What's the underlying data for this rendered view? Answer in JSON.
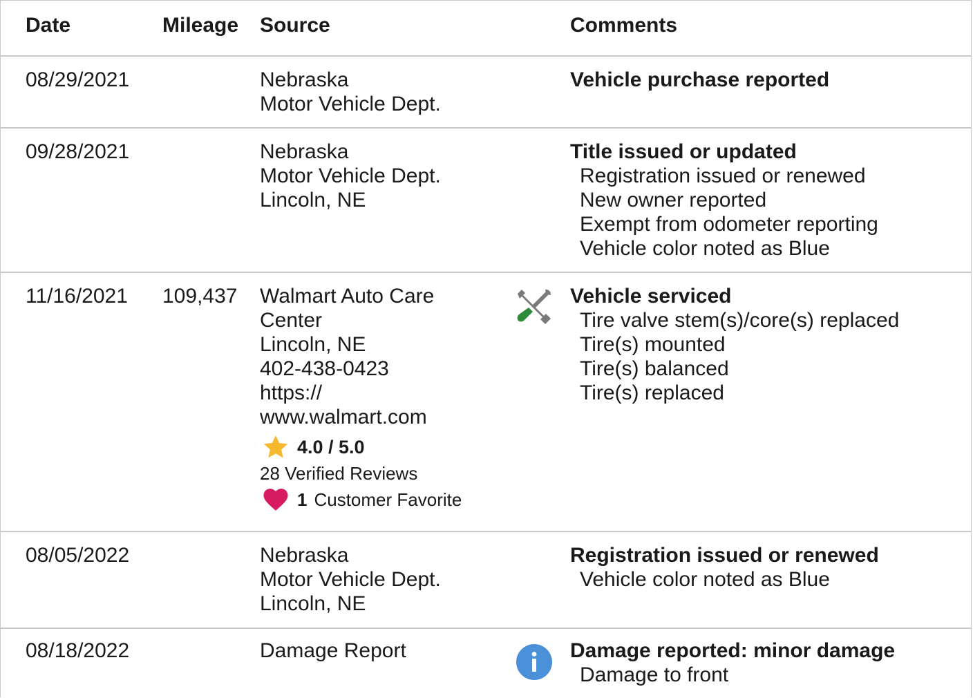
{
  "header": {
    "date": "Date",
    "mileage": "Mileage",
    "source": "Source",
    "comments": "Comments"
  },
  "rows": [
    {
      "date": "08/29/2021",
      "mileage": "",
      "source": [
        "Nebraska",
        "Motor Vehicle Dept."
      ],
      "icon": "",
      "comment_title": "Vehicle purchase reported",
      "comment_details": []
    },
    {
      "date": "09/28/2021",
      "mileage": "",
      "source": [
        "Nebraska",
        "Motor Vehicle Dept.",
        "Lincoln, NE"
      ],
      "icon": "",
      "comment_title": "Title issued or updated",
      "comment_details": [
        "Registration issued or renewed",
        "New owner reported",
        "Exempt from odometer reporting",
        "Vehicle color noted as Blue"
      ]
    },
    {
      "date": "11/16/2021",
      "mileage": "109,437",
      "source": [
        "Walmart Auto Care",
        "Center",
        "Lincoln, NE",
        "402-438-0423",
        "https://",
        "www.walmart.com"
      ],
      "rating": "4.0 / 5.0",
      "reviews": "28 Verified Reviews",
      "favorite_count": "1",
      "favorite_label": "Customer Favorite",
      "icon": "wrench-screwdriver-icon",
      "comment_title": "Vehicle serviced",
      "comment_details": [
        "Tire valve stem(s)/core(s) replaced",
        "Tire(s) mounted",
        "Tire(s) balanced",
        "Tire(s) replaced"
      ]
    },
    {
      "date": "08/05/2022",
      "mileage": "",
      "source": [
        "Nebraska",
        "Motor Vehicle Dept.",
        "Lincoln, NE"
      ],
      "icon": "",
      "comment_title": "Registration issued or renewed",
      "comment_details": [
        "Vehicle color noted as Blue"
      ]
    },
    {
      "date": "08/18/2022",
      "mileage": "",
      "source": [
        "Damage Report"
      ],
      "icon": "info-icon",
      "comment_title": "Damage reported: minor damage",
      "comment_details": [
        "Damage to front"
      ]
    }
  ],
  "colors": {
    "border": "#c8c8c8",
    "star": "#f5b82e",
    "heart": "#d81b60",
    "info": "#4a90d9",
    "wrench_gray": "#7a7a7a",
    "screwdriver_green": "#2e8b3a"
  }
}
